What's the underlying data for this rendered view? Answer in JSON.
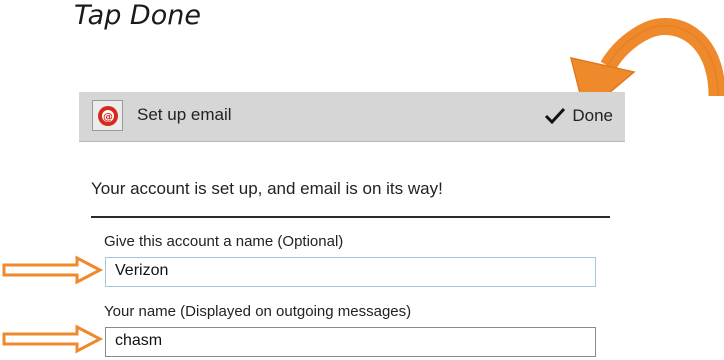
{
  "instruction": "Tap Done",
  "action_bar": {
    "app_icon": "email-app-icon",
    "title": "Set up email",
    "done_label": "Done",
    "done_icon": "checkmark-icon"
  },
  "confirmation": "Your account is set up, and email is on its way!",
  "fields": {
    "account_name": {
      "label": "Give this account a name (Optional)",
      "value": "Verizon"
    },
    "your_name": {
      "label": "Your name (Displayed on outgoing messages)",
      "value": "chasm"
    }
  },
  "colors": {
    "annotation_arrow": "#ef8a2c",
    "action_bar": "#d6d6d6",
    "field_focus_border": "#9fc9dc"
  }
}
